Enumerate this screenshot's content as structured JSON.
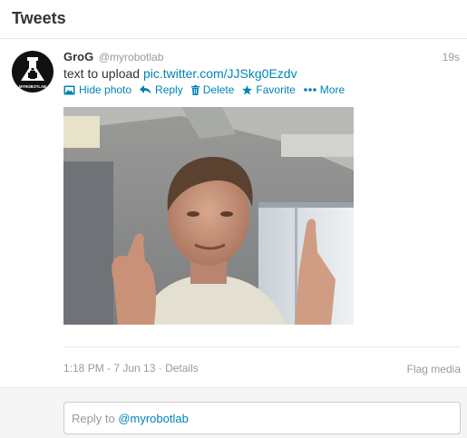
{
  "header": {
    "title": "Tweets"
  },
  "tweet": {
    "name": "GroG",
    "handle": "@myrobotlab",
    "time": "19s",
    "text": "text to upload ",
    "link": "pic.twitter.com/JJSkg0Ezdv",
    "avatar_label": "MYROBOTLAB",
    "actions": {
      "hide_photo": "Hide photo",
      "reply": "Reply",
      "delete": "Delete",
      "favorite": "Favorite",
      "more": "More"
    },
    "timestamp": "1:18 PM - 7 Jun 13",
    "separator": " · ",
    "details": "Details",
    "flag_media": "Flag media"
  },
  "reply": {
    "prefix": "Reply to ",
    "mention": "@myrobotlab"
  },
  "colors": {
    "link": "#0084b4",
    "muted": "#999999",
    "text": "#333333"
  },
  "icons": [
    "robot-logo-icon",
    "photo-icon",
    "reply-arrow-icon",
    "trash-icon",
    "star-icon",
    "ellipsis-icon"
  ]
}
